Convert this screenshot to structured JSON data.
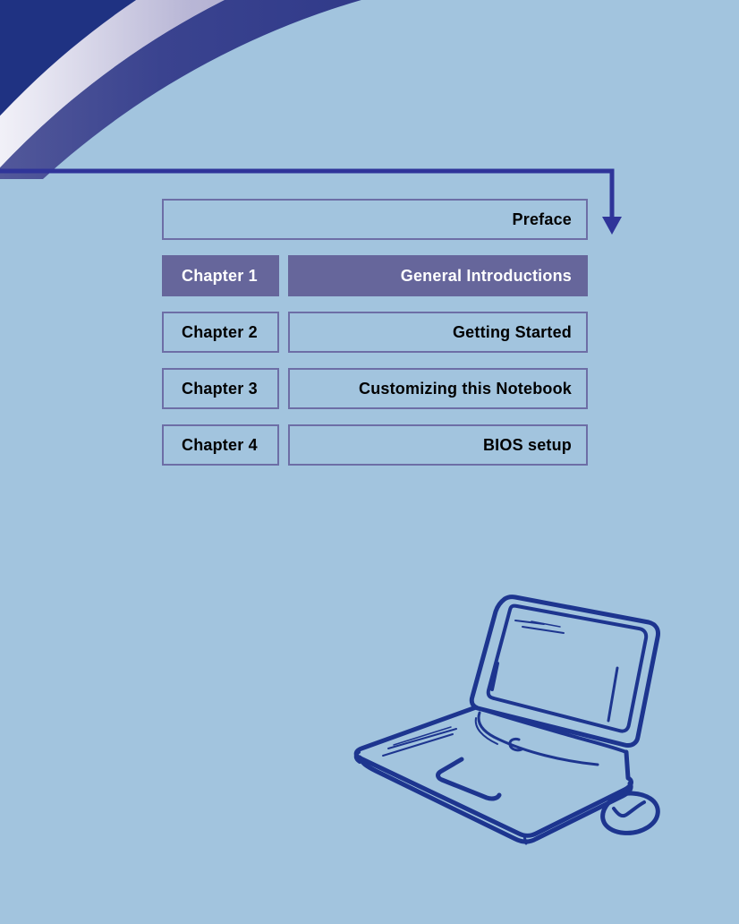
{
  "page": {
    "background_color": "#a2c4de",
    "banner_navy": "#1f3282",
    "accent_purple": "#66669b",
    "border_purple": "#6d6ea6",
    "sketch_navy": "#1d358f"
  },
  "banner": {
    "name": "decorative-arc-banner"
  },
  "connector": {
    "name": "preface-pointer-arrow"
  },
  "toc": {
    "rows": [
      {
        "chapter_label": "",
        "title": "Preface",
        "current": false
      },
      {
        "chapter_label": "Chapter  1",
        "title": "General Introductions",
        "current": true
      },
      {
        "chapter_label": "Chapter  2",
        "title": "Getting Started",
        "current": false
      },
      {
        "chapter_label": "Chapter  3",
        "title": "Customizing this Notebook",
        "current": false
      },
      {
        "chapter_label": "Chapter  4",
        "title": "BIOS setup",
        "current": false
      }
    ]
  },
  "illustration": {
    "name": "notebook-and-mouse-sketch"
  }
}
